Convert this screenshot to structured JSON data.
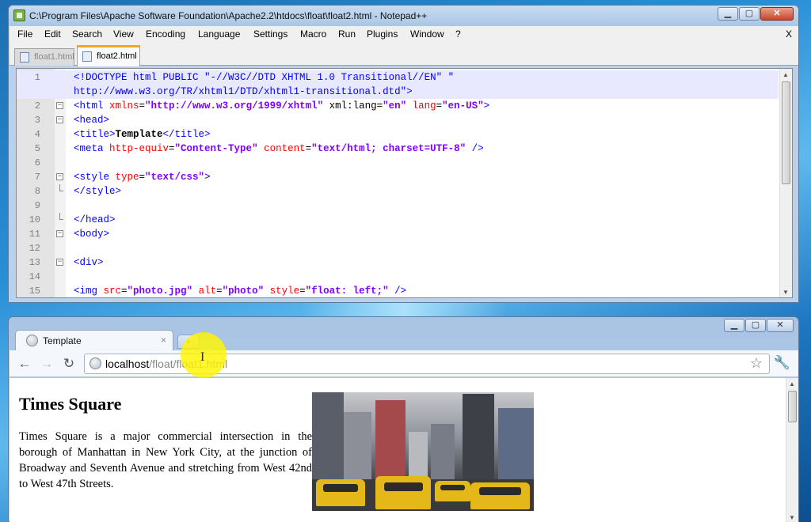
{
  "notepad": {
    "title": "C:\\Program Files\\Apache Software Foundation\\Apache2.2\\htdocs\\float\\float2.html - Notepad++",
    "menu": [
      "File",
      "Edit",
      "Search",
      "View",
      "Encoding",
      "Language",
      "Settings",
      "Macro",
      "Run",
      "Plugins",
      "Window",
      "?"
    ],
    "menu_close": "X",
    "tabs": [
      {
        "label": "float1.html",
        "active": false
      },
      {
        "label": "float2.html",
        "active": true
      }
    ],
    "lines": [
      {
        "num": "1",
        "parts": [
          {
            "t": "<!DOCTYPE html PUBLIC \"-//W3C//DTD XHTML 1.0 Transitional//EN\" \"",
            "c": "t"
          }
        ]
      },
      {
        "num": "",
        "parts": [
          {
            "t": "http://www.w3.org/TR/xhtml1/DTD/xhtml1-transitional.dtd\">",
            "c": "t"
          }
        ]
      },
      {
        "num": "2",
        "parts": [
          {
            "t": "<html ",
            "c": "t"
          },
          {
            "t": "xmlns",
            "c": "a"
          },
          {
            "t": "=",
            "c": "p"
          },
          {
            "t": "\"http://www.w3.org/1999/xhtml\"",
            "c": "v"
          },
          {
            "t": " xml:lang=",
            "c": "p"
          },
          {
            "t": "\"en\"",
            "c": "v"
          },
          {
            "t": " lang",
            "c": "a"
          },
          {
            "t": "=",
            "c": "p"
          },
          {
            "t": "\"en-US\"",
            "c": "v"
          },
          {
            "t": ">",
            "c": "t"
          }
        ]
      },
      {
        "num": "3",
        "parts": [
          {
            "t": "<head>",
            "c": "t"
          }
        ]
      },
      {
        "num": "4",
        "parts": [
          {
            "t": "<title>",
            "c": "t"
          },
          {
            "t": "Template",
            "c": "b"
          },
          {
            "t": "</title>",
            "c": "t"
          }
        ]
      },
      {
        "num": "5",
        "parts": [
          {
            "t": "<meta ",
            "c": "t"
          },
          {
            "t": "http-equiv",
            "c": "a"
          },
          {
            "t": "=",
            "c": "p"
          },
          {
            "t": "\"Content-Type\"",
            "c": "v"
          },
          {
            "t": " content",
            "c": "a"
          },
          {
            "t": "=",
            "c": "p"
          },
          {
            "t": "\"text/html; charset=UTF-8\"",
            "c": "v"
          },
          {
            "t": " />",
            "c": "t"
          }
        ]
      },
      {
        "num": "6",
        "parts": []
      },
      {
        "num": "7",
        "parts": [
          {
            "t": "<style ",
            "c": "t"
          },
          {
            "t": "type",
            "c": "a"
          },
          {
            "t": "=",
            "c": "p"
          },
          {
            "t": "\"text/css\"",
            "c": "v"
          },
          {
            "t": ">",
            "c": "t"
          }
        ]
      },
      {
        "num": "8",
        "parts": [
          {
            "t": "</style>",
            "c": "t"
          }
        ]
      },
      {
        "num": "9",
        "parts": []
      },
      {
        "num": "10",
        "parts": [
          {
            "t": "</head>",
            "c": "t"
          }
        ]
      },
      {
        "num": "11",
        "parts": [
          {
            "t": "<body>",
            "c": "t"
          }
        ]
      },
      {
        "num": "12",
        "parts": []
      },
      {
        "num": "13",
        "parts": [
          {
            "t": "<div>",
            "c": "t"
          }
        ]
      },
      {
        "num": "14",
        "parts": []
      },
      {
        "num": "15",
        "parts": [
          {
            "t": "<img ",
            "c": "t"
          },
          {
            "t": "src",
            "c": "a"
          },
          {
            "t": "=",
            "c": "p"
          },
          {
            "t": "\"photo.jpg\"",
            "c": "v"
          },
          {
            "t": " alt",
            "c": "a"
          },
          {
            "t": "=",
            "c": "p"
          },
          {
            "t": "\"photo\"",
            "c": "v"
          },
          {
            "t": " style",
            "c": "a"
          },
          {
            "t": "=",
            "c": "p"
          },
          {
            "t": "\"float: left;\"",
            "c": "v"
          },
          {
            "t": " />",
            "c": "t"
          }
        ]
      }
    ]
  },
  "browser": {
    "tab_title": "Template",
    "tab_close": "×",
    "new_tab": "+",
    "url_host": "localhost",
    "url_path": "/float/float1.html",
    "page": {
      "heading": "Times Square",
      "paragraph": "Times Square is a major commercial intersection in the borough of Manhattan in New York City, at the junction of Broadway and Seventh Avenue and stretching from West 42nd to West 47th Streets."
    }
  },
  "colors": {
    "accent_tab": "#f7a51b",
    "tag": "#0000ff",
    "attr": "#ff0000",
    "value": "#8000ff",
    "current_line": "#e8e8ff"
  },
  "icons": [
    "notepad-icon",
    "file-icon",
    "globe-icon",
    "back-icon",
    "forward-icon",
    "reload-icon",
    "star-icon",
    "wrench-icon"
  ]
}
